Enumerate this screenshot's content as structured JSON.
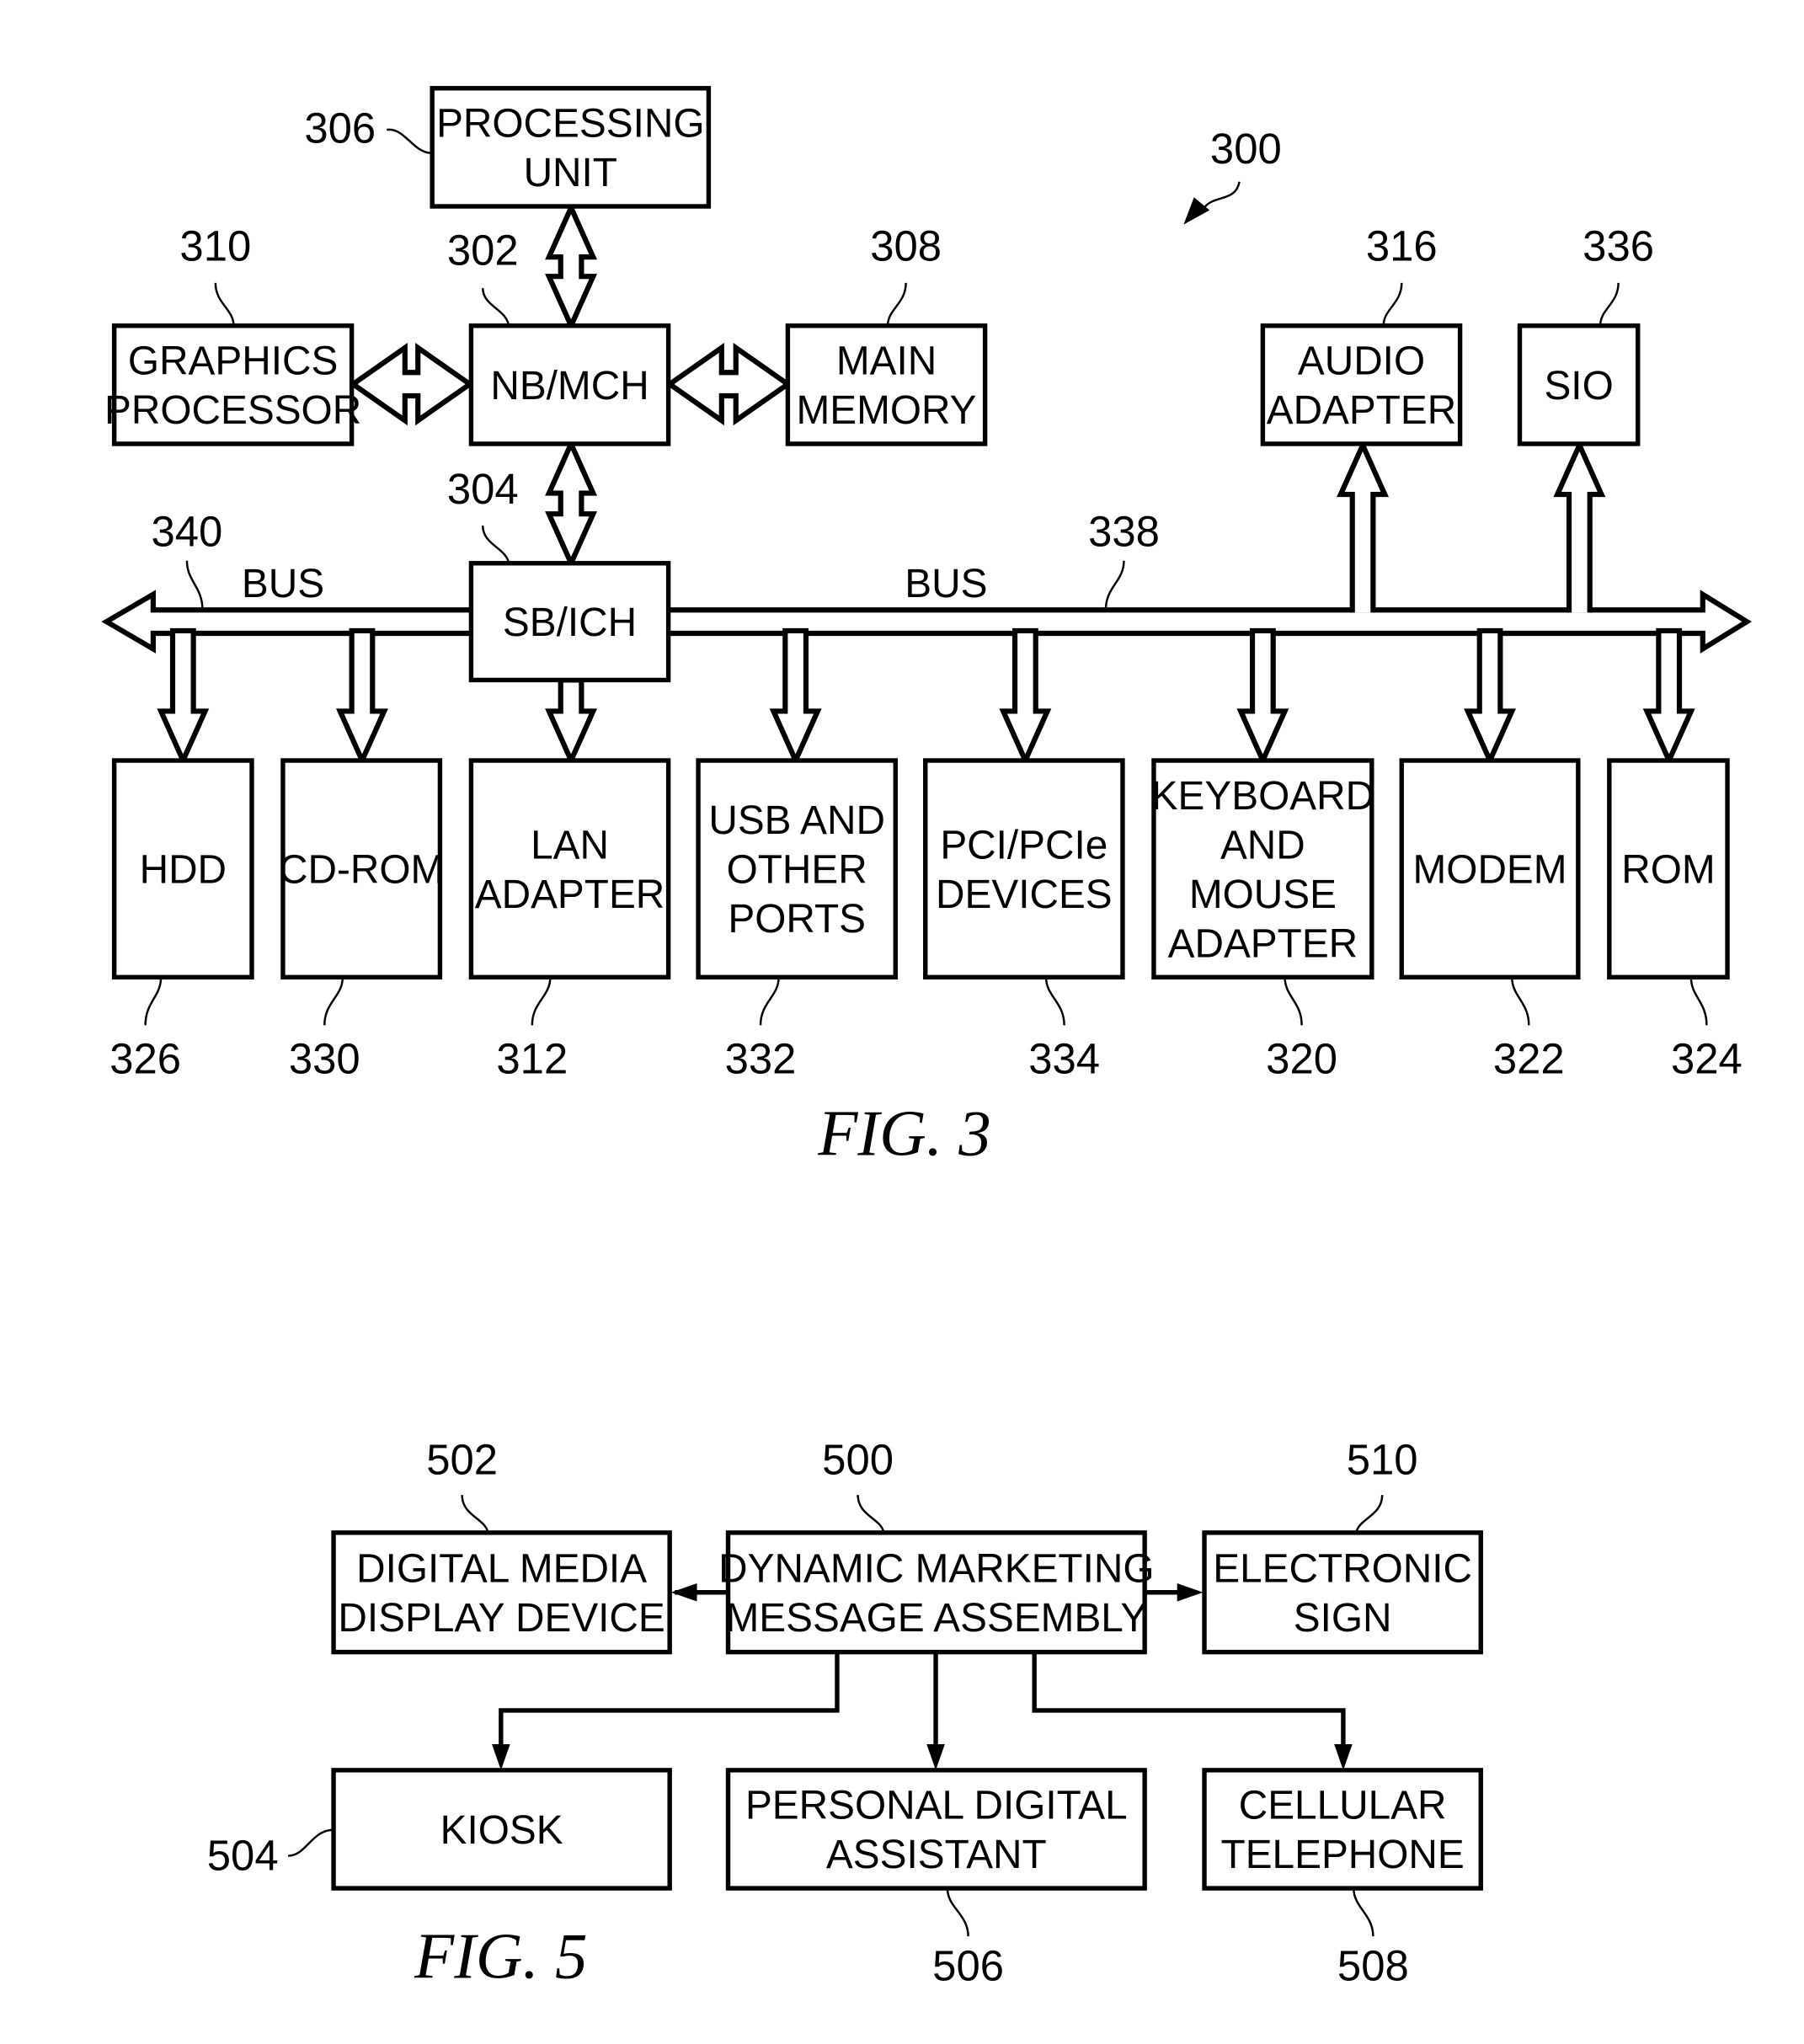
{
  "fig3": {
    "caption": "FIG. 3",
    "system_ref": "300",
    "bus_left": {
      "label": "BUS",
      "ref": "340"
    },
    "bus_right": {
      "label": "BUS",
      "ref": "338"
    },
    "blocks": {
      "processing_unit": {
        "lines": [
          "PROCESSING",
          "UNIT"
        ],
        "ref": "306"
      },
      "nb_mch": {
        "lines": [
          "NB/MCH"
        ],
        "ref": "302"
      },
      "graphics_processor": {
        "lines": [
          "GRAPHICS",
          "PROCESSOR"
        ],
        "ref": "310"
      },
      "main_memory": {
        "lines": [
          "MAIN",
          "MEMORY"
        ],
        "ref": "308"
      },
      "sb_ich": {
        "lines": [
          "SB/ICH"
        ],
        "ref": "304"
      },
      "audio_adapter": {
        "lines": [
          "AUDIO",
          "ADAPTER"
        ],
        "ref": "316"
      },
      "sio": {
        "lines": [
          "SIO"
        ],
        "ref": "336"
      },
      "hdd": {
        "lines": [
          "HDD"
        ],
        "ref": "326"
      },
      "cd_rom": {
        "lines": [
          "CD-ROM"
        ],
        "ref": "330"
      },
      "lan_adapter": {
        "lines": [
          "LAN",
          "ADAPTER"
        ],
        "ref": "312"
      },
      "usb_ports": {
        "lines": [
          "USB AND",
          "OTHER",
          "PORTS"
        ],
        "ref": "332"
      },
      "pci_devices": {
        "lines": [
          "PCI/PCIe",
          "DEVICES"
        ],
        "ref": "334"
      },
      "keyboard_mouse": {
        "lines": [
          "KEYBOARD",
          "AND",
          "MOUSE",
          "ADAPTER"
        ],
        "ref": "320"
      },
      "modem": {
        "lines": [
          "MODEM"
        ],
        "ref": "322"
      },
      "rom": {
        "lines": [
          "ROM"
        ],
        "ref": "324"
      }
    }
  },
  "fig5": {
    "caption": "FIG. 5",
    "blocks": {
      "digital_media": {
        "lines": [
          "DIGITAL MEDIA",
          "DISPLAY DEVICE"
        ],
        "ref": "502"
      },
      "dmma": {
        "lines": [
          "DYNAMIC MARKETING",
          "MESSAGE ASSEMBLY"
        ],
        "ref": "500"
      },
      "electronic_sign": {
        "lines": [
          "ELECTRONIC",
          "SIGN"
        ],
        "ref": "510"
      },
      "kiosk": {
        "lines": [
          "KIOSK"
        ],
        "ref": "504"
      },
      "pda": {
        "lines": [
          "PERSONAL DIGITAL",
          "ASSISTANT"
        ],
        "ref": "506"
      },
      "cell_phone": {
        "lines": [
          "CELLULAR",
          "TELEPHONE"
        ],
        "ref": "508"
      }
    }
  }
}
